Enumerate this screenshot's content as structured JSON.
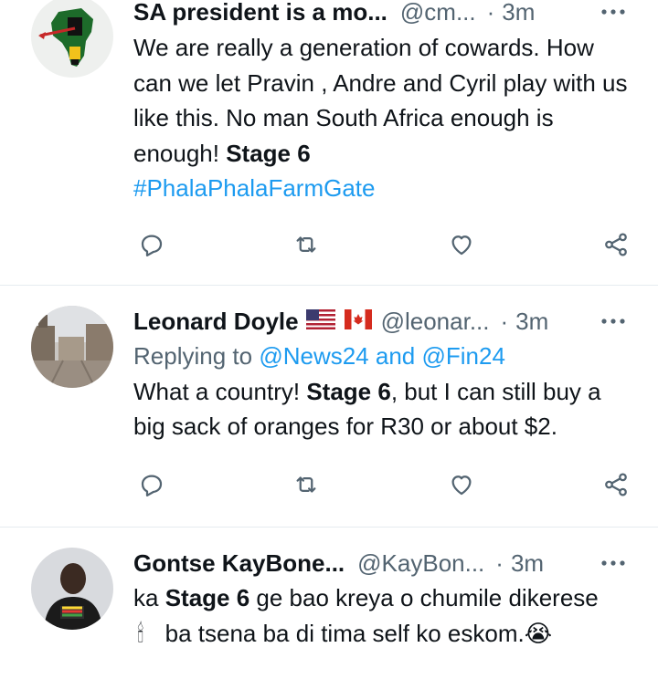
{
  "tweets": [
    {
      "name": "SA president is a mo...",
      "handle": "@cm...",
      "separator": "·",
      "time": "3m",
      "avatar_icon": "africa-map-icon",
      "body_parts": [
        "We are really a generation of cowards. How can we let Pravin , Andre and Cyril play with us like this. No man South Africa enough is enough! ",
        "Stage 6"
      ],
      "hashtag": "#PhalaPhalaFarmGate"
    },
    {
      "name": "Leonard Doyle",
      "flags": [
        "us-flag-icon",
        "canada-flag-icon"
      ],
      "handle": "@leonar...",
      "separator": "·",
      "time": "3m",
      "avatar_icon": "city-street-icon",
      "reply_prefix": "Replying to ",
      "reply_user1": "@News24",
      "reply_and": " and ",
      "reply_user2": "@Fin24",
      "body_start": "What a country! ",
      "body_bold": "Stage 6",
      "body_end": ", but I can still buy a big sack of oranges for R30 or about $2."
    },
    {
      "name": "Gontse KayBone...",
      "handle": "@KayBon...",
      "separator": "·",
      "time": "3m",
      "avatar_icon": "person-photo-icon",
      "body_start": "ka ",
      "body_bold": "Stage 6",
      "body_mid": " ge bao kreya o chumile dikerese",
      "candle": "🕯",
      "body_end": " ba tsena ba di tima self ko eskom.",
      "emoji": "😭"
    }
  ],
  "colors": {
    "link": "#1d9bf0",
    "muted": "#536471",
    "text": "#0f1419",
    "divider": "#e6ecf0"
  }
}
